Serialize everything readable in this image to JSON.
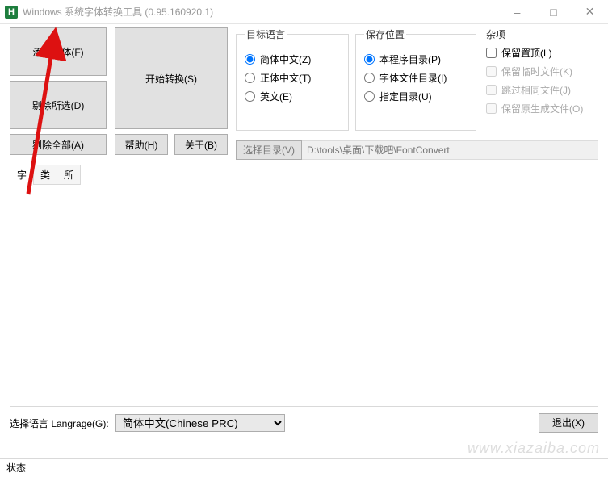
{
  "window": {
    "icon_letter": "H",
    "title": "Windows 系统字体转换工具 (0.95.160920.1)"
  },
  "buttons": {
    "add_font": "添加字体(F)",
    "remove_selected": "剔除所选(D)",
    "remove_all": "剔除全部(A)",
    "start": "开始转换(S)",
    "help": "帮助(H)",
    "about": "关于(B)",
    "select_dir": "选择目录(V)",
    "exit": "退出(X)"
  },
  "groups": {
    "target_lang": {
      "legend": "目标语言",
      "opt_simplified": "简体中文(Z)",
      "opt_traditional": "正体中文(T)",
      "opt_english": "英文(E)",
      "selected": "simplified"
    },
    "save_loc": {
      "legend": "保存位置",
      "opt_program_dir": "本程序目录(P)",
      "opt_font_dir": "字体文件目录(I)",
      "opt_custom_dir": "指定目录(U)",
      "selected": "program_dir"
    },
    "misc": {
      "legend": "杂项",
      "keep_placement": "保留置顶(L)",
      "keep_temp": "保留临时文件(K)",
      "skip_same": "跳过相同文件(J)",
      "keep_original": "保留原生成文件(O)"
    }
  },
  "path_value": "D:\\tools\\桌面\\下载吧\\FontConvert",
  "tabs": {
    "t1": "字",
    "t2": "类",
    "t3": "所"
  },
  "lang_select": {
    "label": "选择语言 Langrage(G):",
    "value": "简体中文(Chinese PRC)"
  },
  "status": {
    "label": "状态"
  },
  "watermark": "www.xiazaiba.com"
}
